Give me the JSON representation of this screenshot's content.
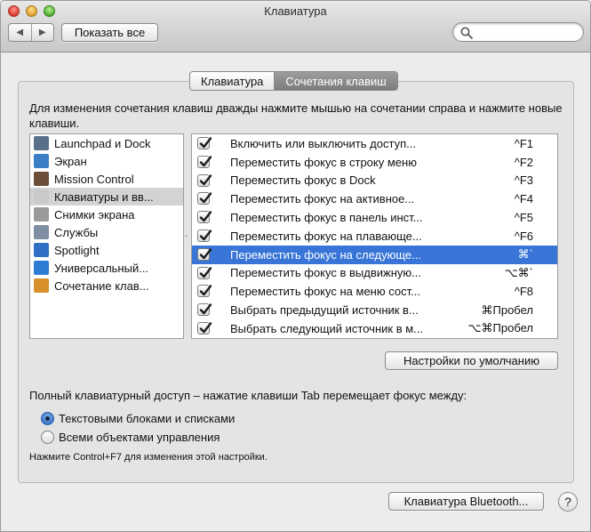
{
  "window": {
    "title": "Клавиатура"
  },
  "toolbar": {
    "back_glyph": "◀",
    "forward_glyph": "▶",
    "show_all_label": "Показать все",
    "search_placeholder": ""
  },
  "tabs": [
    {
      "label": "Клавиатура",
      "active": false
    },
    {
      "label": "Сочетания клавиш",
      "active": true
    }
  ],
  "instructions": "Для изменения сочетания клавиш дважды нажмите мышью на сочетании справа и нажмите новые клавиши.",
  "categories": [
    {
      "label": "Launchpad и Dock",
      "icon": "launchpad-icon",
      "color": "#5a6f8a"
    },
    {
      "label": "Экран",
      "icon": "display-icon",
      "color": "#3a7fc6"
    },
    {
      "label": "Mission Control",
      "icon": "mission-control-icon",
      "color": "#6b4f3a"
    },
    {
      "label": "Клавиатуры и вв...",
      "icon": "keyboard-icon",
      "color": "#c9c9c9",
      "selected": true
    },
    {
      "label": "Снимки экрана",
      "icon": "screenshot-icon",
      "color": "#9a9a9a"
    },
    {
      "label": "Службы",
      "icon": "gear-icon",
      "color": "#7e8fa3"
    },
    {
      "label": "Spotlight",
      "icon": "spotlight-icon",
      "color": "#2f6fc4"
    },
    {
      "label": "Универсальный...",
      "icon": "accessibility-icon",
      "color": "#2d7bd4"
    },
    {
      "label": "Сочетание клав...",
      "icon": "app-shortcuts-icon",
      "color": "#d8902a"
    }
  ],
  "shortcuts": [
    {
      "label": "Включить или выключить доступ...",
      "key": "^F1",
      "checked": true
    },
    {
      "label": "Переместить фокус в строку меню",
      "key": "^F2",
      "checked": true
    },
    {
      "label": "Переместить фокус в Dock",
      "key": "^F3",
      "checked": true
    },
    {
      "label": "Переместить фокус на активное...",
      "key": "^F4",
      "checked": true
    },
    {
      "label": "Переместить фокус в панель инст...",
      "key": "^F5",
      "checked": true
    },
    {
      "label": "Переместить фокус на плавающе...",
      "key": "^F6",
      "checked": true
    },
    {
      "label": "Переместить фокус на следующе...",
      "key": "⌘`",
      "checked": true,
      "selected": true
    },
    {
      "label": "Переместить фокус в выдвижную...",
      "key": "⌥⌘`",
      "checked": true
    },
    {
      "label": "Переместить фокус на меню сост...",
      "key": "^F8",
      "checked": true
    },
    {
      "label": "Выбрать предыдущий источник в...",
      "key": "⌘Пробел",
      "checked": true
    },
    {
      "label": "Выбрать следующий источник в м...",
      "key": "⌥⌘Пробел",
      "checked": true
    }
  ],
  "defaults_label": "Настройки по умолчанию",
  "full_keyboard": {
    "label": "Полный клавиатурный доступ – нажатие клавиши Tab перемещает фокус между:",
    "options": [
      {
        "label": "Текстовыми блоками и списками",
        "selected": true
      },
      {
        "label": "Всеми объектами управления",
        "selected": false
      }
    ],
    "hint": "Нажмите Control+F7 для изменения этой настройки."
  },
  "bluetooth_label": "Клавиатура Bluetooth...",
  "help_glyph": "?",
  "colors": {
    "selection": "#3875d7",
    "tab_active": "#8a8a8a"
  }
}
